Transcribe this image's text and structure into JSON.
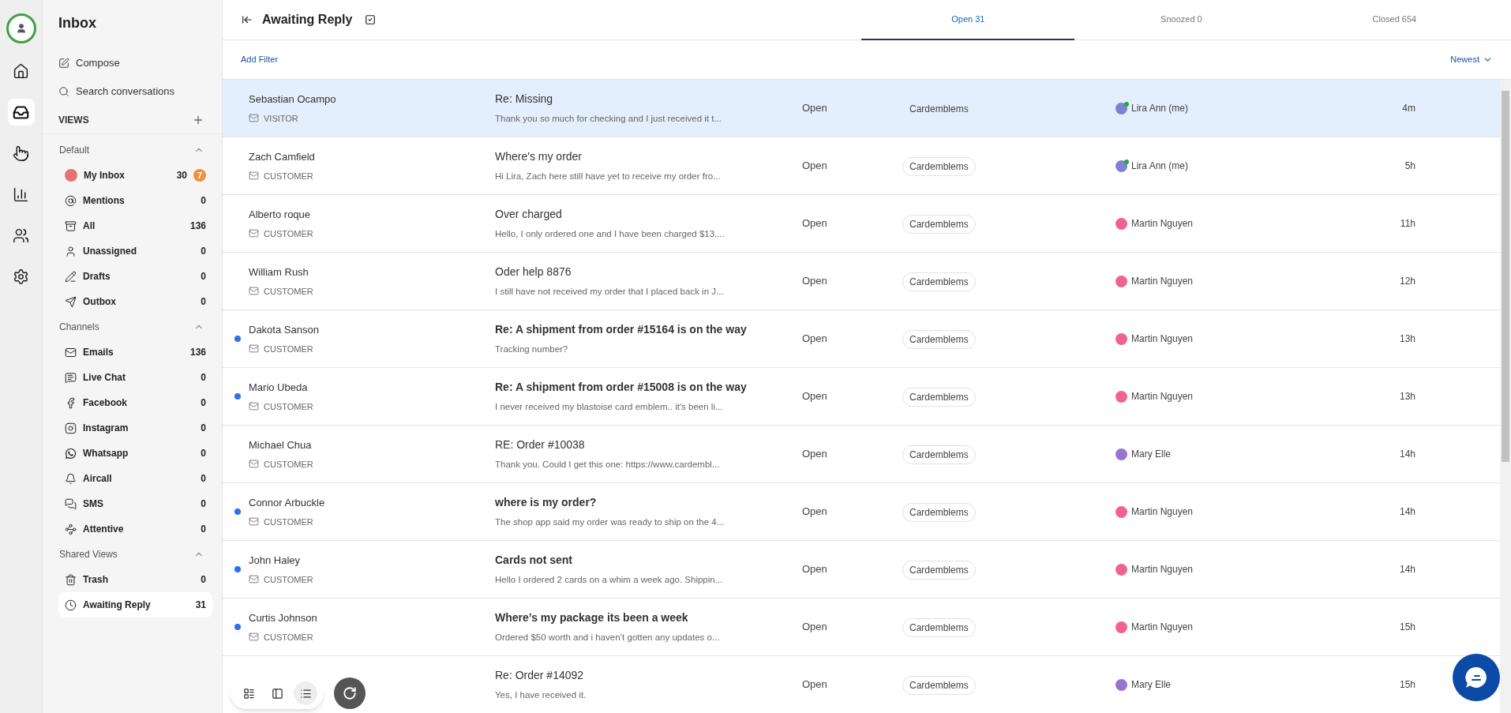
{
  "rail": [
    {
      "kind": "home",
      "selected": false
    },
    {
      "kind": "inbox",
      "selected": true
    },
    {
      "kind": "pointer",
      "selected": false
    },
    {
      "kind": "chart",
      "selected": false
    },
    {
      "kind": "team",
      "selected": false
    },
    {
      "kind": "settings",
      "selected": false
    }
  ],
  "sidebar": {
    "title": "Inbox",
    "actions": [
      {
        "kind": "compose",
        "label": "Compose"
      },
      {
        "kind": "search",
        "label": "Search conversations"
      }
    ],
    "views_title": "VIEWS",
    "sections": [
      {
        "title": "Default",
        "expanded": true,
        "items": [
          {
            "kind": "me",
            "label": "My Inbox",
            "count": "30",
            "badge": "7",
            "selected": false
          },
          {
            "kind": "mentions",
            "label": "Mentions",
            "count": "0",
            "selected": false
          },
          {
            "kind": "all",
            "label": "All",
            "count": "136",
            "selected": false
          },
          {
            "kind": "unassigned",
            "label": "Unassigned",
            "count": "0",
            "selected": false
          },
          {
            "kind": "drafts",
            "label": "Drafts",
            "count": "0",
            "selected": false
          },
          {
            "kind": "outbox",
            "label": "Outbox",
            "count": "0",
            "selected": false
          }
        ]
      },
      {
        "title": "Channels",
        "expanded": true,
        "items": [
          {
            "kind": "email",
            "label": "Emails",
            "count": "136",
            "selected": false
          },
          {
            "kind": "chat",
            "label": "Live Chat",
            "count": "0",
            "selected": false
          },
          {
            "kind": "facebook",
            "label": "Facebook",
            "count": "0",
            "selected": false
          },
          {
            "kind": "instagram",
            "label": "Instagram",
            "count": "0",
            "selected": false
          },
          {
            "kind": "whatsapp",
            "label": "Whatsapp",
            "count": "0",
            "selected": false
          },
          {
            "kind": "aircall",
            "label": "Aircall",
            "count": "0",
            "selected": false
          },
          {
            "kind": "sms",
            "label": "SMS",
            "count": "0",
            "selected": false
          },
          {
            "kind": "attentive",
            "label": "Attentive",
            "count": "0",
            "selected": false
          }
        ]
      },
      {
        "title": "Shared Views",
        "expanded": true,
        "items": [
          {
            "kind": "trash",
            "label": "Trash",
            "count": "0",
            "selected": false
          },
          {
            "kind": "clock",
            "label": "Awaiting Reply",
            "count": "31",
            "selected": true
          }
        ]
      }
    ]
  },
  "header": {
    "title": "Awaiting Reply",
    "tabs": [
      {
        "label": "Open 31",
        "selected": true
      },
      {
        "label": "Snoozed 0",
        "selected": false
      },
      {
        "label": "Closed 654",
        "selected": false
      }
    ]
  },
  "filter_bar": {
    "add_filter": "Add Filter",
    "sort": "Newest"
  },
  "conversations": [
    {
      "name": "Sebastian Ocampo",
      "role": "VISITOR",
      "subject": "Re: Missing",
      "preview": "Thank you so much for checking and I just received it t...",
      "status": "Open",
      "tag": "Cardemblems",
      "assignee": "Lira Ann (me)",
      "color": "#7c83d6",
      "online": true,
      "time": "4m",
      "unread": false,
      "selected": true
    },
    {
      "name": "Zach Camfield",
      "role": "CUSTOMER",
      "subject": "Where's my order",
      "preview": "Hi Lira, Zach here still have yet to receive my order fro...",
      "status": "Open",
      "tag": "Cardemblems",
      "assignee": "Lira Ann (me)",
      "color": "#7c83d6",
      "online": true,
      "time": "5h",
      "unread": false,
      "selected": false
    },
    {
      "name": "Alberto roque",
      "role": "CUSTOMER",
      "subject": "Over charged",
      "preview": "Hello, I only ordered one and I have been charged $13....",
      "status": "Open",
      "tag": "Cardemblems",
      "assignee": "Martin Nguyen",
      "color": "#f06292",
      "online": false,
      "time": "11h",
      "unread": false,
      "selected": false
    },
    {
      "name": "William Rush",
      "role": "CUSTOMER",
      "subject": "Oder help 8876",
      "preview": "I still have not received my order that I placed back in J...",
      "status": "Open",
      "tag": "Cardemblems",
      "assignee": "Martin Nguyen",
      "color": "#f06292",
      "online": false,
      "time": "12h",
      "unread": false,
      "selected": false
    },
    {
      "name": "Dakota Sanson",
      "role": "CUSTOMER",
      "subject": "Re: A shipment from order #15164 is on the way",
      "preview": "Tracking number?",
      "status": "Open",
      "tag": "Cardemblems",
      "assignee": "Martin Nguyen",
      "color": "#f06292",
      "online": false,
      "time": "13h",
      "unread": true,
      "selected": false
    },
    {
      "name": "Mario Ubeda",
      "role": "CUSTOMER",
      "subject": "Re: A shipment from order #15008 is on the way",
      "preview": "I never received my blastoise card emblem.. it's been li...",
      "status": "Open",
      "tag": "Cardemblems",
      "assignee": "Martin Nguyen",
      "color": "#f06292",
      "online": false,
      "time": "13h",
      "unread": true,
      "selected": false
    },
    {
      "name": "Michael Chua",
      "role": "CUSTOMER",
      "subject": "RE: Order #10038",
      "preview": "Thank you. Could I get this one: https://www.cardembl...",
      "status": "Open",
      "tag": "Cardemblems",
      "assignee": "Mary Elle",
      "color": "#9575cd",
      "online": false,
      "time": "14h",
      "unread": false,
      "selected": false
    },
    {
      "name": "Connor Arbuckle",
      "role": "CUSTOMER",
      "subject": "where is my order?",
      "preview": "The shop app said my order was ready to ship on the 4...",
      "status": "Open",
      "tag": "Cardemblems",
      "assignee": "Martin Nguyen",
      "color": "#f06292",
      "online": false,
      "time": "14h",
      "unread": true,
      "selected": false
    },
    {
      "name": "John Haley",
      "role": "CUSTOMER",
      "subject": "Cards not sent",
      "preview": "Hello I ordered 2 cards on a whim a week ago. Shippin...",
      "status": "Open",
      "tag": "Cardemblems",
      "assignee": "Martin Nguyen",
      "color": "#f06292",
      "online": false,
      "time": "14h",
      "unread": true,
      "selected": false
    },
    {
      "name": "Curtis Johnson",
      "role": "CUSTOMER",
      "subject": "Where’s my package its been a week",
      "preview": "Ordered $50 worth and i haven’t gotten any updates o...",
      "status": "Open",
      "tag": "Cardemblems",
      "assignee": "Martin Nguyen",
      "color": "#f06292",
      "online": false,
      "time": "15h",
      "unread": true,
      "selected": false
    },
    {
      "subject": "Re: Order #14092",
      "preview": "Yes, I have received it.",
      "status": "Open",
      "tag": "Cardemblems",
      "assignee": "Mary Elle",
      "color": "#9575cd",
      "online": false,
      "time": "15h",
      "unread": false,
      "selected": false
    }
  ],
  "view_switcher": [
    {
      "kind": "split",
      "selected": false
    },
    {
      "kind": "columns",
      "selected": false
    },
    {
      "kind": "list",
      "selected": true
    }
  ]
}
